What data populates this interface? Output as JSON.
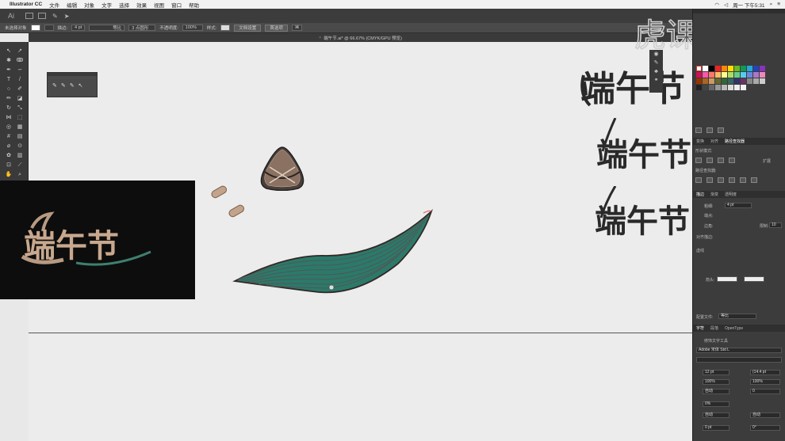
{
  "menubar": {
    "app_name": "Illustrator CC",
    "items": [
      "文件",
      "编辑",
      "对象",
      "文字",
      "选择",
      "效果",
      "视图",
      "窗口",
      "帮助"
    ],
    "clock": "周一 下午5:31"
  },
  "control_bar": {
    "selection_label": "未选择对象",
    "stroke_label": "描边:",
    "stroke_value": "4 pt",
    "stroke_style": "等比",
    "brush": "3 点圆形",
    "opacity_label": "不透明度:",
    "opacity_value": "100%",
    "style_label": "样式:",
    "doc_setup": "文档设置",
    "preferences": "首选项"
  },
  "document_tab": {
    "title": "端午节.ai* @ 66.67% (CMYK/GPU 预览)"
  },
  "artwork": {
    "photo_title": "端午节",
    "logo_text": "端午节"
  },
  "right_panel": {
    "tabs_top": [
      "变换",
      "对齐",
      "路径查找器"
    ],
    "shape_modes_label": "形状模式:",
    "expand_label": "扩展",
    "pathfinder_label": "路径查找器:",
    "tabs_stroke": [
      "描边",
      "渐变",
      "透明度"
    ],
    "weight_label": "粗细:",
    "weight_value": "4 pt",
    "cap_label": "端点:",
    "corner_label": "边角:",
    "limit_label": "限制:",
    "limit_value": "10",
    "align_stroke_label": "对齐描边:",
    "dashed_label": "虚线",
    "arrow_label": "箭头:",
    "profile_label": "配置文件:",
    "profile_value": "等比",
    "tabs_char": [
      "字符",
      "段落",
      "OpenType"
    ],
    "touch_type_label": "修饰文字工具",
    "font_family": "Adobe 宋体 Std L",
    "font_size": "12 pt",
    "leading": "(14.4 pt",
    "scale_v": "100%",
    "scale_h": "100%",
    "kerning": "自动",
    "tracking": "0",
    "tsume": "0%",
    "auto1": "自动",
    "auto2": "自动",
    "baseline": "0 pt",
    "rotation": "0°"
  },
  "watermark": {
    "text": "虎课网"
  }
}
